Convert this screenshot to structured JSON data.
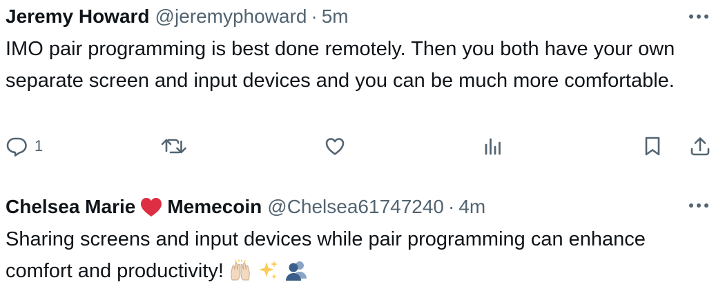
{
  "tweets": [
    {
      "name": "Jeremy Howard",
      "handle": "@jeremyphoward",
      "separator": "·",
      "time": "5m",
      "text": "IMO pair programming is best done remotely. Then you both have your own separate screen and input devices and you can be much more comfortable.",
      "actions": {
        "reply_count": "1",
        "icons": [
          "reply-icon",
          "retweet-icon",
          "like-icon",
          "views-icon",
          "bookmark-icon",
          "share-icon"
        ]
      }
    },
    {
      "name_part1": "Chelsea Marie",
      "name_emoji": "heart-icon",
      "name_part2": "Memecoin",
      "handle": "@Chelsea61747240",
      "separator": "·",
      "time": "4m",
      "text": "Sharing screens and input devices while pair programming can enhance comfort and productivity!",
      "emojis": [
        "raised-hands-icon",
        "sparkles-icon",
        "busts-icon"
      ]
    }
  ],
  "colors": {
    "text": "#0f1419",
    "secondary": "#536471",
    "heart": "#dd2e44",
    "sparkle": "#fdcb58"
  }
}
